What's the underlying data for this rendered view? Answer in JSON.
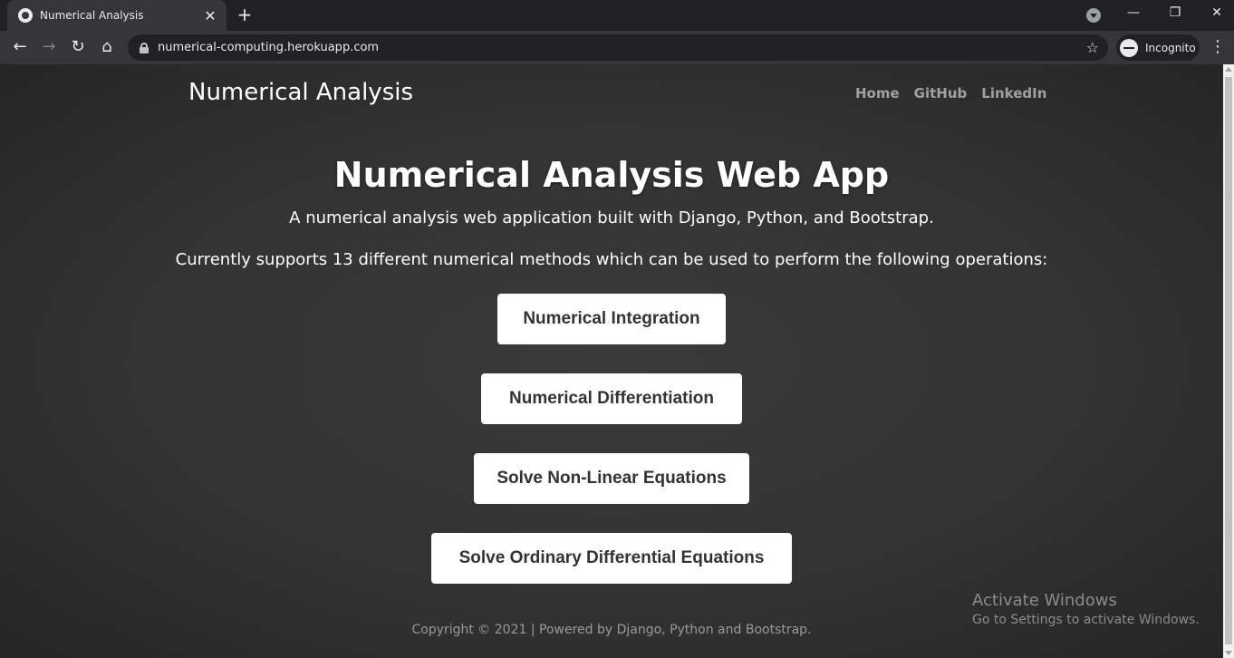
{
  "browser": {
    "tab_title": "Numerical Analysis",
    "url": "numerical-computing.herokuapp.com",
    "incognito_label": "Incognito",
    "icons": {
      "new_tab": "+",
      "close": "✕",
      "back": "←",
      "forward": "→",
      "reload": "↻",
      "home": "⌂",
      "star": "☆",
      "menu": "⋮",
      "minimize": "—",
      "restore": "❐",
      "window_close": "✕"
    }
  },
  "site": {
    "brand": "Numerical Analysis",
    "nav": [
      "Home",
      "GitHub",
      "LinkedIn"
    ]
  },
  "hero": {
    "title": "Numerical Analysis Web App",
    "lead1": "A numerical analysis web application built with Django, Python, and Bootstrap.",
    "lead2": "Currently supports 13 different numerical methods which can be used to perform the following operations:"
  },
  "operations": [
    "Numerical Integration",
    "Numerical Differentiation",
    "Solve Non-Linear Equations",
    "Solve Ordinary Differential Equations"
  ],
  "footer": "Copyright © 2021 | Powered by Django, Python and Bootstrap.",
  "watermark": {
    "title": "Activate Windows",
    "subtitle": "Go to Settings to activate Windows."
  }
}
